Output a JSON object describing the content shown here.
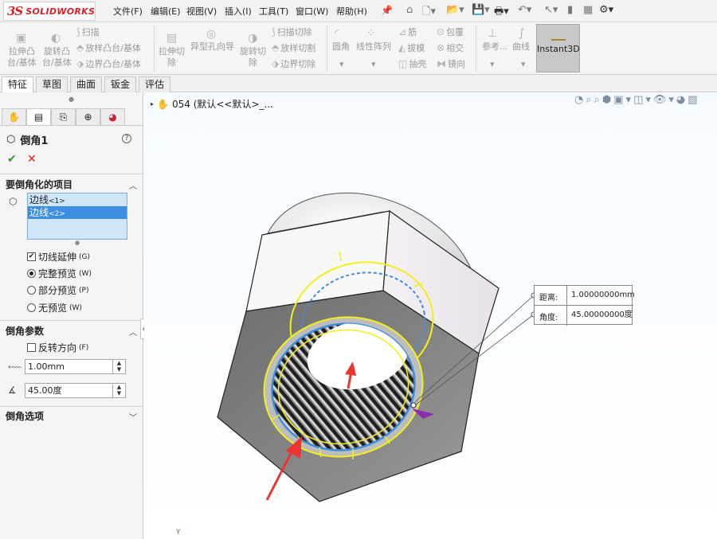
{
  "app": {
    "logo_mark": "3S",
    "logo_text": "SOLIDWORKS"
  },
  "menu": [
    "文件(F)",
    "编辑(E)",
    "视图(V)",
    "插入(I)",
    "工具(T)",
    "窗口(W)",
    "帮助(H)"
  ],
  "command_manager": {
    "boss_extrude": "拉伸凸\n台/基体",
    "revolve_boss": "旋转凸\n台/基体",
    "sweep": "扫描",
    "loft_boss": "放样凸台/基体",
    "boundary_boss": "边界凸台/基体",
    "cut_extrude": "拉伸切\n除",
    "hole_wizard": "异型孔向导",
    "revolve_cut": "旋转切\n除",
    "swept_cut": "扫描切除",
    "lofted_cut": "放样切割",
    "boundary_cut": "边界切除",
    "fillet": "圆角",
    "linear_pattern": "线性阵列",
    "rib": "筋",
    "draft": "拔模",
    "shell": "抽壳",
    "wrap": "包覆",
    "intersect": "相交",
    "mirror": "镜向",
    "reference": "参考...",
    "curves": "曲线",
    "instant3d": "Instant3D"
  },
  "tabs": [
    "特征",
    "草图",
    "曲面",
    "钣金",
    "评估"
  ],
  "panel": {
    "title": "倒角1",
    "help": "?",
    "ok": "✔",
    "cancel": "✕",
    "items_group": "要倒角化的项目",
    "selection": [
      {
        "name": "边线",
        "tag": "<1>"
      },
      {
        "name": "边线",
        "tag": "<2>"
      }
    ],
    "tangent_propagation": {
      "label": "切线延伸",
      "key": "(G)",
      "checked": true
    },
    "preview_full": {
      "label": "完整预览",
      "key": "(W)",
      "selected": true
    },
    "preview_partial": {
      "label": "部分预览",
      "key": "(P)"
    },
    "preview_none": {
      "label": "无预览",
      "key": "(W)"
    },
    "params_group": "倒角参数",
    "flip_direction": {
      "label": "反转方向",
      "key": "(F)",
      "checked": false
    },
    "distance_value": "1.00mm",
    "angle_value": "45.00度",
    "options_group": "倒角选项"
  },
  "viewport": {
    "tree_root": "054 (默认<<默认>_...",
    "callout_distance_label": "距离:",
    "callout_distance_value": "1.00000000mm",
    "callout_angle_label": "角度:",
    "callout_angle_value": "45.00000000度",
    "axis_label": "Y"
  },
  "colors": {
    "accent": "#3d8ee0",
    "selection_bg": "#cfe6f8",
    "edge_highlight": "#f2ee1e",
    "preview": "#3d8ee0",
    "arrow": "#ee3333"
  }
}
